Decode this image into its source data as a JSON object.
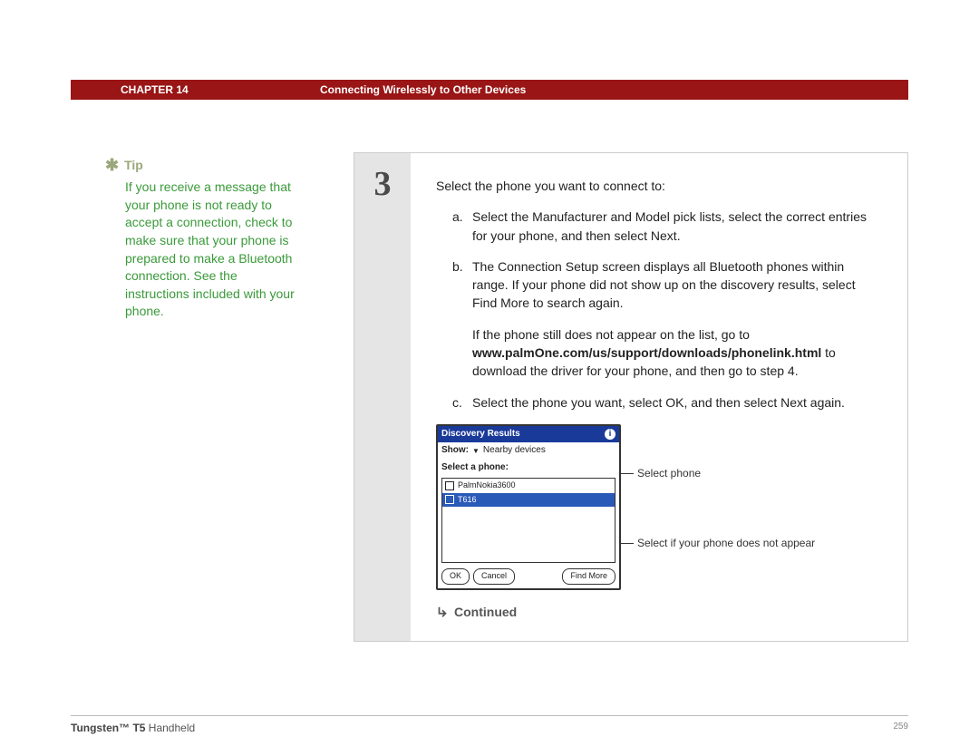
{
  "header": {
    "chapter": "CHAPTER 14",
    "title": "Connecting Wirelessly to Other Devices"
  },
  "tip": {
    "label": "Tip",
    "body": "If you receive a message that your phone is not ready to accept a connection, check to make sure that your phone is prepared to make a Bluetooth connection. See the instructions included with your phone."
  },
  "step": {
    "number": "3",
    "intro": "Select the phone you want to connect to:",
    "items": {
      "a": {
        "letter": "a.",
        "text": "Select the Manufacturer and Model pick lists, select the correct entries for your phone, and then select Next."
      },
      "b": {
        "letter": "b.",
        "text1": "The Connection Setup screen displays all Bluetooth phones within range. If your phone did not show up on the discovery results, select Find More to search again.",
        "text2a": "If the phone still does not appear on the list, go to ",
        "link": "www.palmOne.com/us/support/downloads/phonelink.html",
        "text2b": " to download the driver for your phone, and then go to step 4."
      },
      "c": {
        "letter": "c.",
        "text": "Select the phone you want, select OK, and then select Next again."
      }
    },
    "continued": "Continued"
  },
  "dialog": {
    "title": "Discovery Results",
    "show_label": "Show:",
    "show_value": "Nearby devices",
    "select_label": "Select a phone:",
    "phones": {
      "p1": "PalmNokia3600",
      "p2": "T616"
    },
    "buttons": {
      "ok": "OK",
      "cancel": "Cancel",
      "findmore": "Find More"
    }
  },
  "callouts": {
    "c1": "Select phone",
    "c2": "Select if your phone does not appear"
  },
  "footer": {
    "product_bold": "Tungsten™ T5",
    "product_rest": " Handheld",
    "page": "259"
  }
}
